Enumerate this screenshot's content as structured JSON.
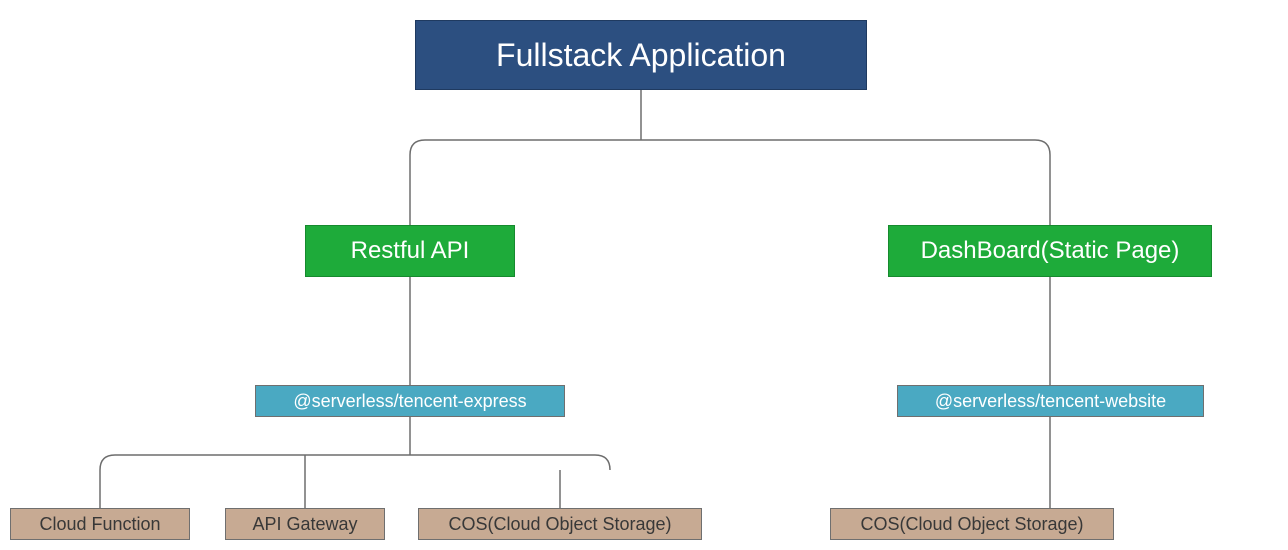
{
  "root": {
    "label": "Fullstack Application"
  },
  "branches": {
    "api": {
      "label": "Restful API"
    },
    "dashboard": {
      "label": "DashBoard(Static Page)"
    }
  },
  "packages": {
    "express": {
      "label": "@serverless/tencent-express"
    },
    "website": {
      "label": "@serverless/tencent-website"
    }
  },
  "leaves": {
    "cloud_function": {
      "label": "Cloud Function"
    },
    "api_gateway": {
      "label": "API Gateway"
    },
    "cos_api": {
      "label": "COS(Cloud Object Storage)"
    },
    "cos_dash": {
      "label": "COS(Cloud Object Storage)"
    }
  },
  "colors": {
    "root_bg": "#2c4f80",
    "branch_bg": "#1eab3a",
    "package_bg": "#4aa9c2",
    "leaf_bg": "#c7aa93",
    "connector": "#6d6d6d"
  }
}
